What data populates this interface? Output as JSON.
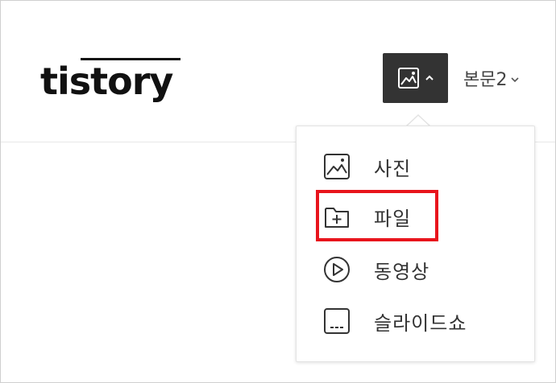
{
  "header": {
    "logo_text": "tistory",
    "toolbar": {
      "image_button_icon": "image-icon",
      "image_button_caret": "chevron-up-icon",
      "paragraph_style_value": "본문2",
      "paragraph_style_caret": "chevron-down-icon"
    }
  },
  "dropdown": {
    "items": [
      {
        "label": "사진",
        "icon": "image-icon"
      },
      {
        "label": "파일",
        "icon": "folder-plus-icon"
      },
      {
        "label": "동영상",
        "icon": "play-circle-icon"
      },
      {
        "label": "슬라이드쇼",
        "icon": "slideshow-icon"
      }
    ],
    "highlighted_item": "파일",
    "highlight_color": "#e8141c"
  },
  "colors": {
    "toolbar_button_bg": "#333333",
    "text": "#333333"
  }
}
